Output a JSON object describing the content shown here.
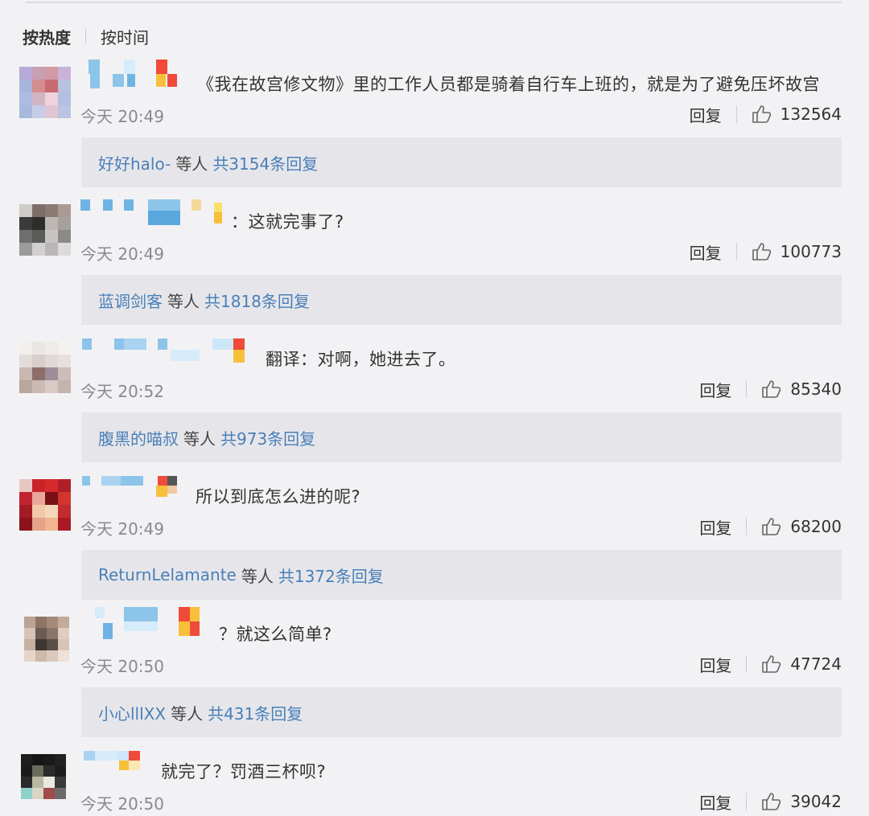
{
  "sort": {
    "hot": "按热度",
    "time": "按时间"
  },
  "comments": [
    {
      "text": "《我在故宫修文物》里的工作人员都是骑着自行车上班的，就是为了避免压坏故宫",
      "time": "今天 20:49",
      "reply_label": "回复",
      "likes": "132564",
      "reply_user": "好好halo-",
      "reply_mid": "等人",
      "reply_count": "共3154条回复"
    },
    {
      "text": "：这就完事了?",
      "time": "今天 20:49",
      "reply_label": "回复",
      "likes": "100773",
      "reply_user": "蓝调剑客",
      "reply_mid": "等人",
      "reply_count": "共1818条回复"
    },
    {
      "text": "翻译：对啊，她进去了。",
      "time": "今天 20:52",
      "reply_label": "回复",
      "likes": "85340",
      "reply_user": "腹黑的喵叔",
      "reply_mid": "等人",
      "reply_count": "共973条回复"
    },
    {
      "text": "所以到底怎么进的呢?",
      "time": "今天 20:49",
      "reply_label": "回复",
      "likes": "68200",
      "reply_user": "ReturnLelamante",
      "reply_mid": "等人",
      "reply_count": "共1372条回复"
    },
    {
      "text": "？就这么简单?",
      "time": "今天 20:50",
      "reply_label": "回复",
      "likes": "47724",
      "reply_user": "小心lllXX",
      "reply_mid": "等人",
      "reply_count": "共431条回复"
    },
    {
      "text": "就完了？罚酒三杯呗?",
      "time": "今天 20:50",
      "reply_label": "回复",
      "likes": "39042"
    }
  ],
  "icons": {
    "like": "thumbs-up-icon"
  },
  "colors": {
    "link": "#4a7fb8",
    "background": "#f2f2f5",
    "reply_box": "#e6e6ea"
  }
}
